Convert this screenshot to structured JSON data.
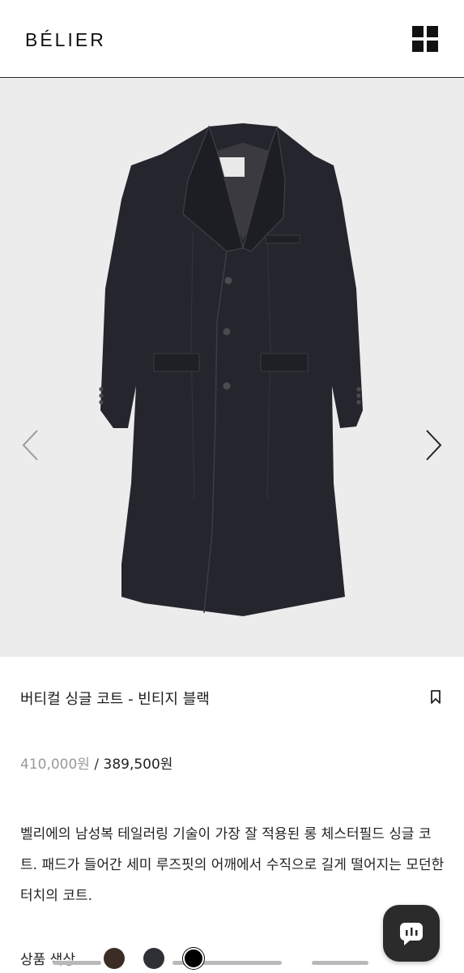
{
  "header": {
    "logo": "BÉLIER",
    "menu_icon": "grid-menu-icon"
  },
  "gallery": {
    "prev_icon": "chevron-left-icon",
    "next_icon": "chevron-right-icon",
    "image": "black-single-coat-photo",
    "colors": {
      "background": "#ececed",
      "coat": "#25262d"
    }
  },
  "product": {
    "title": "버티컬 싱글 코트 - 빈티지 블랙",
    "bookmark_icon": "bookmark-icon",
    "original_price": "410,000원",
    "price_separator": "/",
    "sale_price": "389,500원",
    "description": "벨리에의 남성복 테일러링 기술이 가장 잘 적용된 롱 체스터필드 싱글 코트. 패드가 들어간 세미 루즈핏의 어깨에서 수직으로 길게 떨어지는 모던한 터치의 코트."
  },
  "colors_section": {
    "label": "상품 색상",
    "swatches": [
      {
        "name": "brown",
        "color": "#3b2d26"
      },
      {
        "name": "charcoal",
        "color": "#2f3036"
      },
      {
        "name": "black",
        "color": "#000000",
        "selected": true
      }
    ]
  },
  "chat": {
    "icon": "chat-bubble-icon",
    "color": "#2b2b2b"
  }
}
